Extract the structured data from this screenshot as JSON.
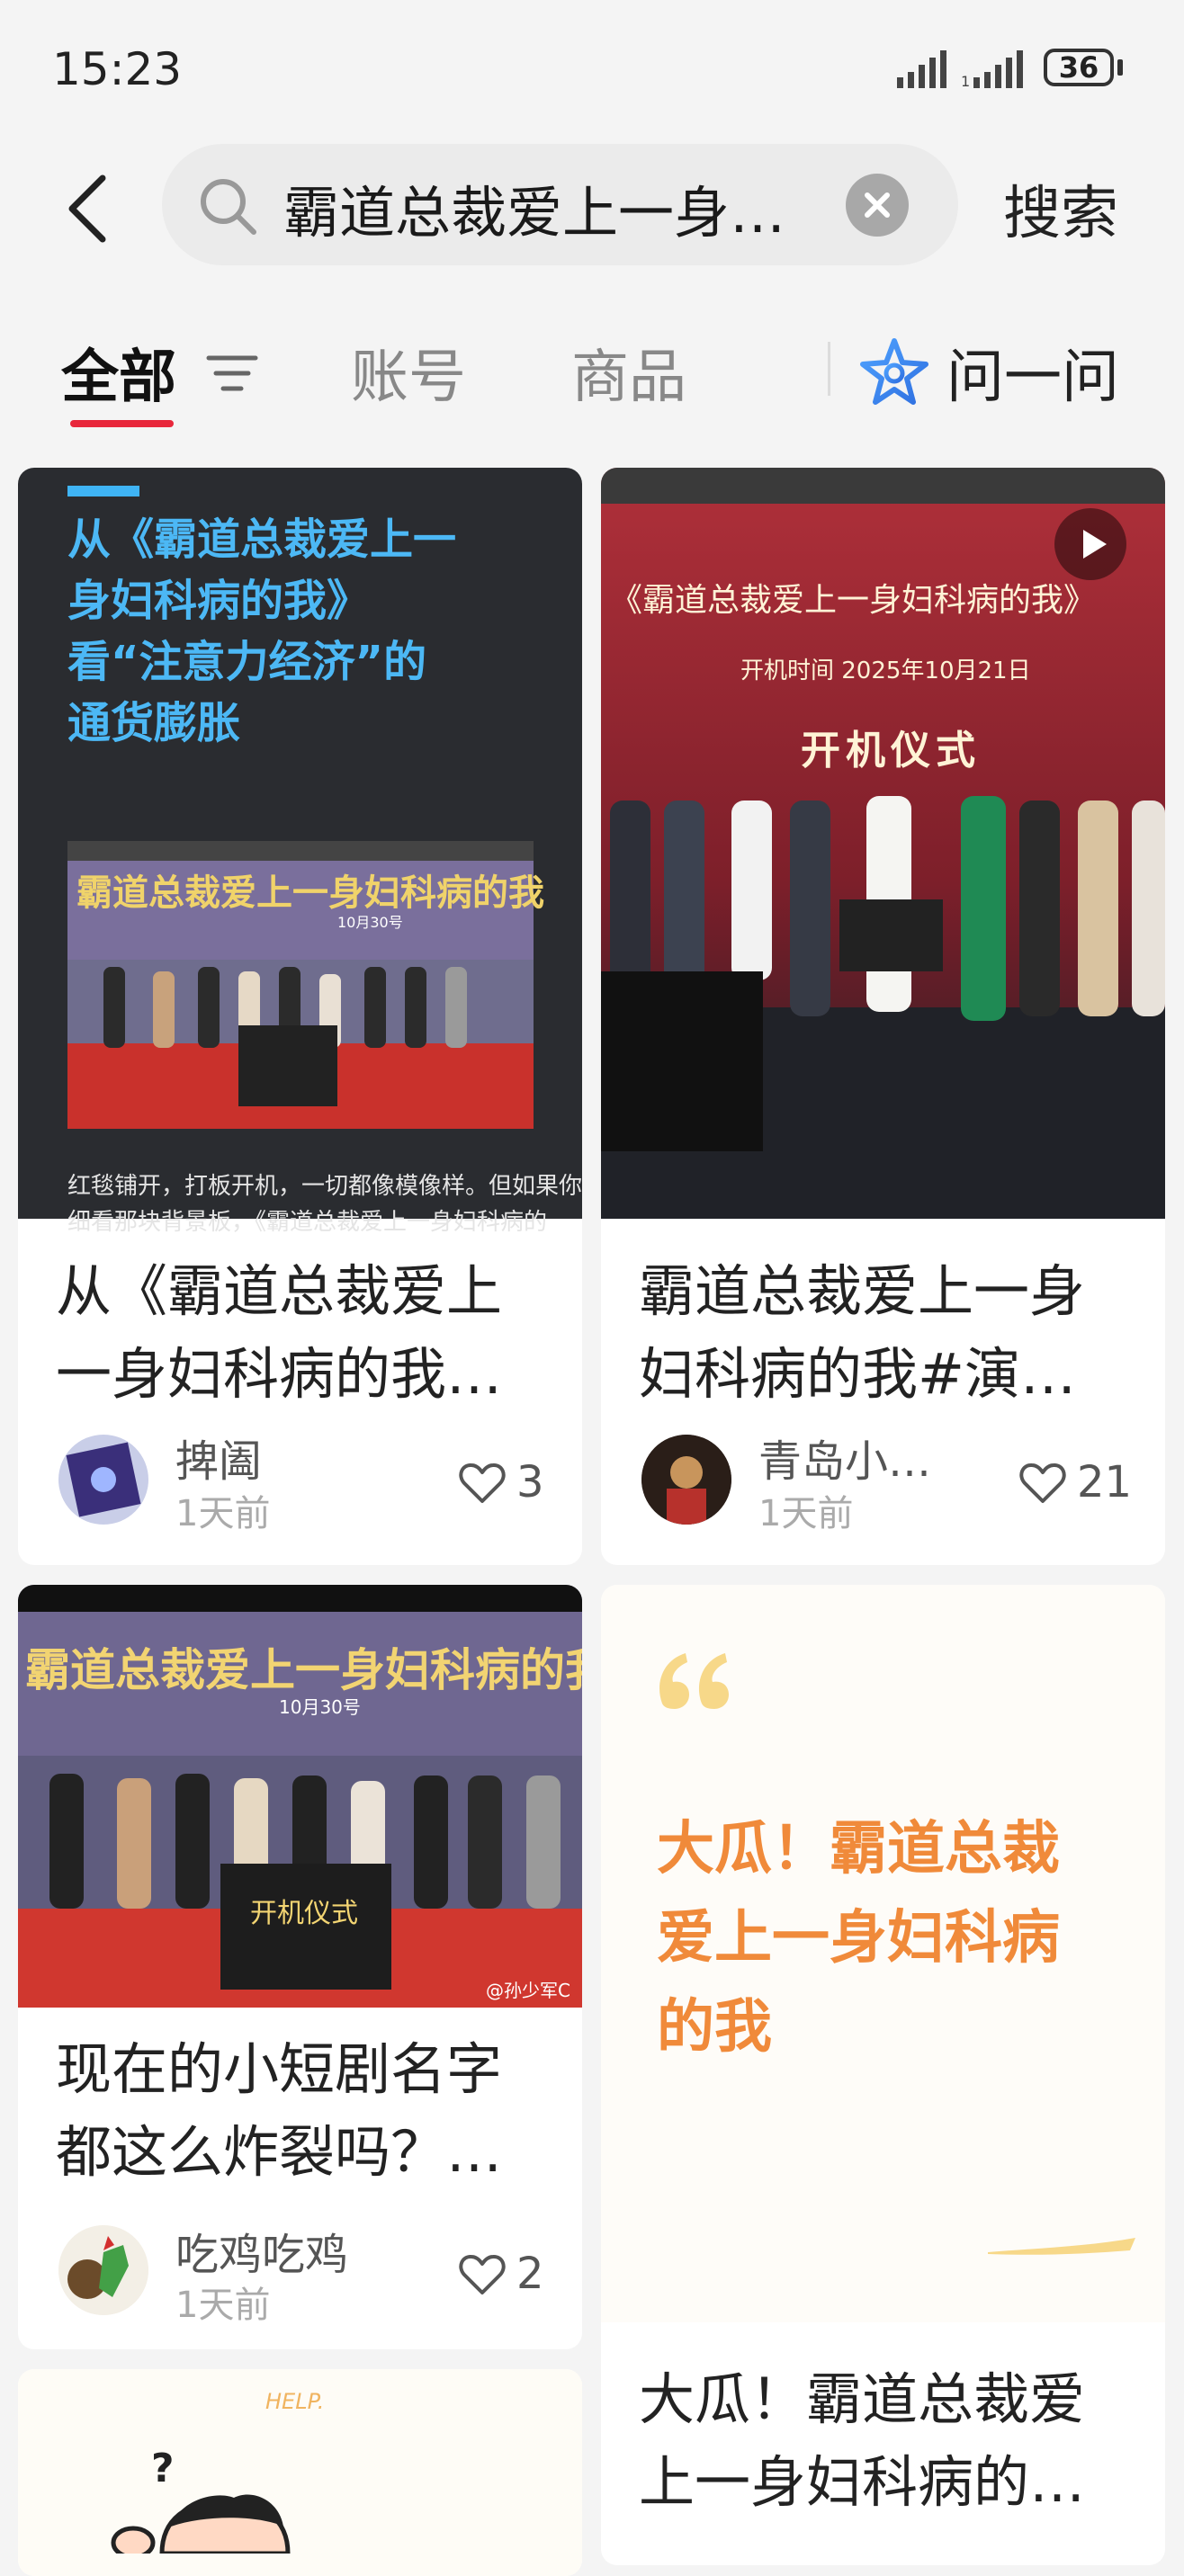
{
  "status": {
    "time": "15:23",
    "battery": "36"
  },
  "search": {
    "query": "霸道总裁爱上一身…",
    "button": "搜索"
  },
  "tabs": {
    "all": "全部",
    "account": "账号",
    "goods": "商品",
    "ask": "问一问"
  },
  "cards": [
    {
      "image_title_lines": [
        "从《霸道总裁爱上一",
        "身妇科病的我》",
        "看“注意力经济”的",
        "通货膨胀"
      ],
      "image_banner": "霸道总裁爱上一身妇科病的我",
      "image_banner_date": "10月30号",
      "image_caption_1": "红毯铺开，打板开机，一切都像模像样。但如果你",
      "image_caption_2": "细看那块背景板，《霸道总裁爱上一身妇科病的",
      "title_line1": "从《霸道总裁爱上",
      "title_line2": "一身妇科病的我…",
      "author": "捭阖",
      "ago": "1天前",
      "likes": "3"
    },
    {
      "image_title": "《霸道总裁爱上一身妇科病的我》",
      "image_sub": "开机时间  2025年10月21日",
      "image_ceremony": "开机仪式",
      "title_line1": "霸道总裁爱上一身",
      "title_line2": "妇科病的我#演…",
      "author": "青岛小…",
      "ago": "1天前",
      "likes": "21"
    },
    {
      "image_banner": "霸道总裁爱上一身妇科病的我",
      "image_banner_date": "10月30号",
      "image_ceremony": "开机仪式",
      "image_watermark": "@孙少军C",
      "title_line1": "现在的小短剧名字",
      "title_line2": "都这么炸裂吗？…",
      "author": "吃鸡吃鸡",
      "ago": "1天前",
      "likes": "2"
    },
    {
      "quote_lines": [
        "大瓜！霸道总裁",
        "爱上一身妇科病",
        "的我"
      ],
      "title_line1": "大瓜！霸道总裁爱",
      "title_line2": "上一身妇科病的…"
    },
    {
      "image_help": "HELP."
    }
  ]
}
